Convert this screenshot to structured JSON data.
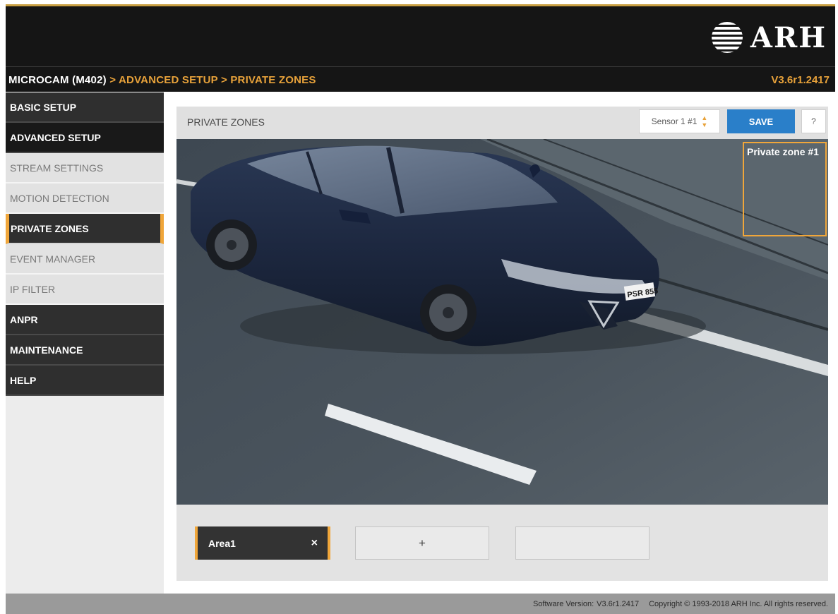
{
  "header": {
    "logo_text": "ARH",
    "breadcrumb": {
      "device": "MICROCAM (M402)",
      "separator": ">",
      "section": "ADVANCED SETUP",
      "page": "PRIVATE ZONES"
    },
    "version": "V3.6r1.2417"
  },
  "sidebar": {
    "items": [
      {
        "label": "BASIC SETUP"
      },
      {
        "label": "ADVANCED SETUP"
      },
      {
        "label": "STREAM SETTINGS"
      },
      {
        "label": "MOTION DETECTION"
      },
      {
        "label": "PRIVATE ZONES"
      },
      {
        "label": "EVENT MANAGER"
      },
      {
        "label": "IP FILTER"
      },
      {
        "label": "ANPR"
      },
      {
        "label": "MAINTENANCE"
      },
      {
        "label": "HELP"
      }
    ]
  },
  "panel": {
    "title": "PRIVATE ZONES",
    "sensor_select": {
      "value": "Sensor 1 #1",
      "icon": "select-arrows-icon"
    },
    "save_label": "SAVE",
    "help_label": "?"
  },
  "camera": {
    "plate_text": "PSR 855",
    "zone_label": "Private zone #1",
    "zone_color": "#f0a63a"
  },
  "areas": {
    "items": [
      {
        "label": "Area1",
        "close": "×"
      }
    ],
    "add_label": "+"
  },
  "footer": {
    "software_version_label": "Software Version:",
    "software_version_value": "V3.6r1.2417",
    "copyright": "Copyright © 1993-2018 ARH Inc. All rights reserved."
  },
  "colors": {
    "accent": "#e8a23a",
    "save_button": "#2a7fc9",
    "header_bg": "#151515",
    "sidebar_dark": "#2f2f2f"
  }
}
